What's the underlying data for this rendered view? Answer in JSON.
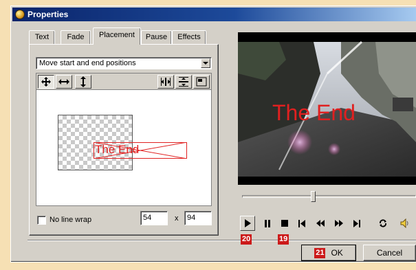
{
  "window": {
    "title": "Properties"
  },
  "tabs": [
    {
      "label": "Text"
    },
    {
      "label": "Fade"
    },
    {
      "label": "Placement"
    },
    {
      "label": "Pause"
    },
    {
      "label": "Effects"
    }
  ],
  "active_tab": "Placement",
  "placement": {
    "mode_value": "Move start and end positions",
    "preview_text": "The End",
    "no_line_wrap_label": "No line wrap",
    "no_line_wrap_checked": false,
    "x_value": "54",
    "separator": "x",
    "y_value": "94"
  },
  "video": {
    "overlay_text": "The End",
    "overlay_color": "#e02020"
  },
  "seek": {
    "position_fraction": 0.41
  },
  "player": {
    "buttons": [
      "play-icon",
      "pause-icon",
      "stop-icon",
      "skip-to-start-icon",
      "rewind-icon",
      "fast-forward-icon",
      "skip-to-end-icon",
      "loop-icon",
      "volume-icon"
    ]
  },
  "callouts": {
    "play": "20",
    "stop": "19",
    "ok": "21",
    "color": "#cc1a1a"
  },
  "dialog_buttons": {
    "ok": "OK",
    "cancel": "Cancel"
  }
}
